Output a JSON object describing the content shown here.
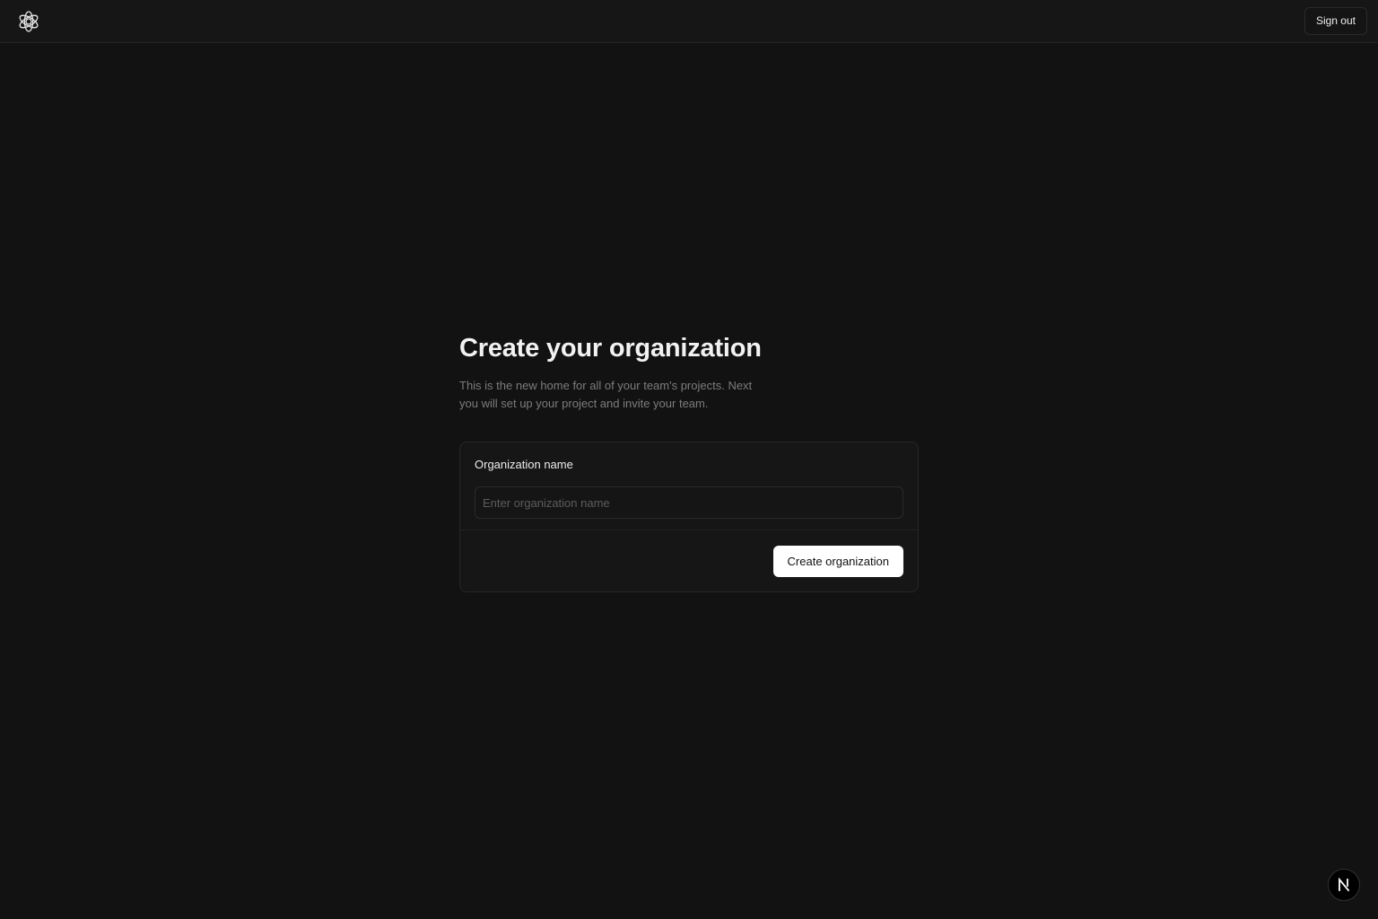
{
  "header": {
    "logo_icon": "flower-logo-icon",
    "signout_label": "Sign out"
  },
  "main": {
    "title": "Create your organization",
    "description": "This is the new home for all of your team's projects. Next you will set up your project and invite your team."
  },
  "form": {
    "org_name_label": "Organization name",
    "org_name_value": "",
    "org_name_placeholder": "Enter organization name",
    "submit_label": "Create organization"
  },
  "badge": {
    "icon": "nextjs-n-icon"
  },
  "colors": {
    "background": "#121212",
    "topbar": "#161616",
    "card": "#161616",
    "primary_button": "#ffffff"
  }
}
